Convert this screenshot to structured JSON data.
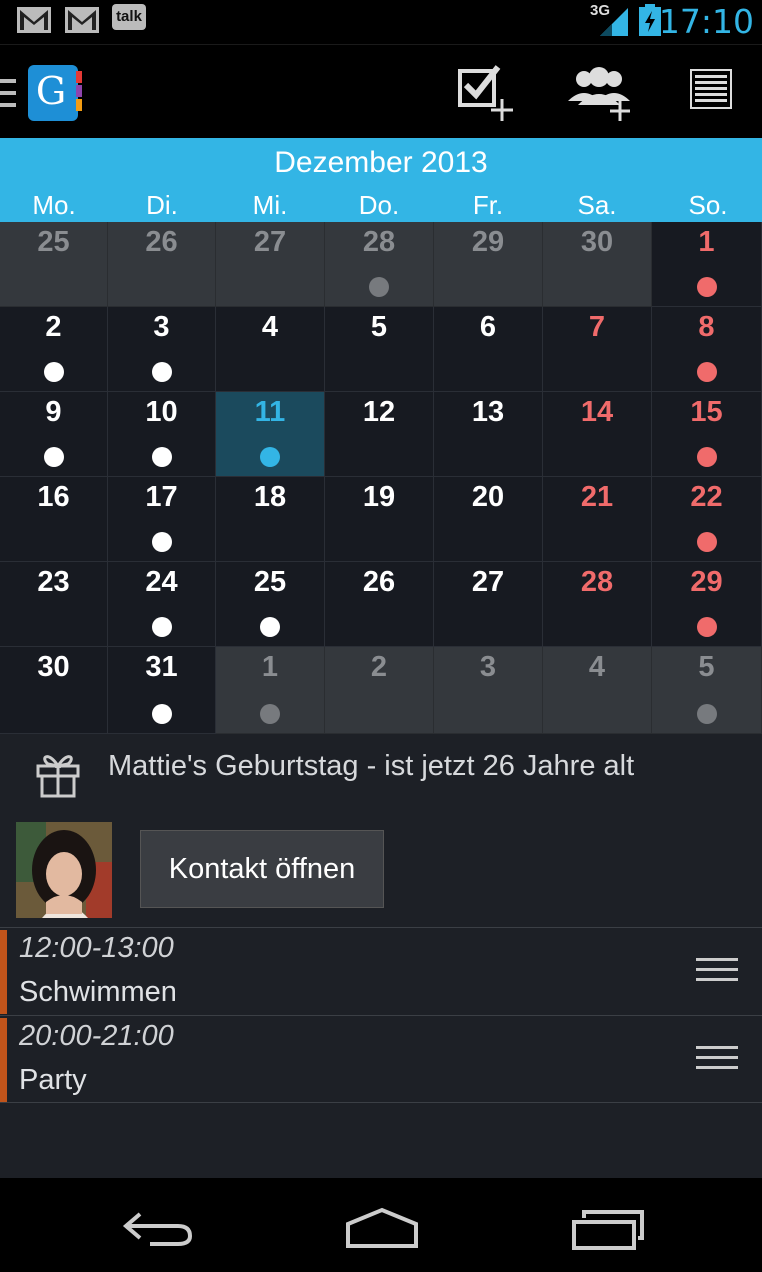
{
  "status_bar": {
    "notifications": [
      "gmail-icon",
      "gmail-icon",
      "talk-icon"
    ],
    "talk_label": "talk",
    "network_label": "3G",
    "time": "17:10",
    "accent": "#33b5e5"
  },
  "action_bar": {
    "app_logo_letter": "G",
    "actions": [
      "add-task-icon",
      "add-contact-icon",
      "list-view-icon"
    ]
  },
  "calendar": {
    "month_title": "Dezember 2013",
    "weekdays": [
      "Mo.",
      "Di.",
      "Mi.",
      "Do.",
      "Fr.",
      "Sa.",
      "So."
    ],
    "weeks": [
      [
        {
          "d": "25",
          "o": true
        },
        {
          "d": "26",
          "o": true
        },
        {
          "d": "27",
          "o": true
        },
        {
          "d": "28",
          "o": true,
          "dot": "grey"
        },
        {
          "d": "29",
          "o": true
        },
        {
          "d": "30",
          "o": true
        },
        {
          "d": "1",
          "red": true,
          "dot": "red"
        }
      ],
      [
        {
          "d": "2",
          "dot": "white"
        },
        {
          "d": "3",
          "dot": "white"
        },
        {
          "d": "4"
        },
        {
          "d": "5"
        },
        {
          "d": "6"
        },
        {
          "d": "7",
          "red": true
        },
        {
          "d": "8",
          "red": true,
          "dot": "red"
        }
      ],
      [
        {
          "d": "9",
          "dot": "white"
        },
        {
          "d": "10",
          "dot": "white"
        },
        {
          "d": "11",
          "today": true,
          "dot": "blue"
        },
        {
          "d": "12"
        },
        {
          "d": "13"
        },
        {
          "d": "14",
          "red": true
        },
        {
          "d": "15",
          "red": true,
          "dot": "red"
        }
      ],
      [
        {
          "d": "16"
        },
        {
          "d": "17",
          "dot": "white"
        },
        {
          "d": "18"
        },
        {
          "d": "19"
        },
        {
          "d": "20"
        },
        {
          "d": "21",
          "red": true
        },
        {
          "d": "22",
          "red": true,
          "dot": "red"
        }
      ],
      [
        {
          "d": "23"
        },
        {
          "d": "24",
          "dot": "white"
        },
        {
          "d": "25",
          "dot": "white"
        },
        {
          "d": "26"
        },
        {
          "d": "27"
        },
        {
          "d": "28",
          "red": true
        },
        {
          "d": "29",
          "red": true,
          "dot": "red"
        }
      ],
      [
        {
          "d": "30"
        },
        {
          "d": "31",
          "dot": "white"
        },
        {
          "d": "1",
          "o": true,
          "dot": "grey"
        },
        {
          "d": "2",
          "o": true
        },
        {
          "d": "3",
          "o": true
        },
        {
          "d": "4",
          "o": true
        },
        {
          "d": "5",
          "o": true,
          "dot": "grey"
        }
      ]
    ],
    "colors": {
      "weekend_red": "#f06b6b",
      "header_blue": "#33b5e5"
    }
  },
  "birthday": {
    "text": "Mattie's Geburtstag - ist jetzt 26 Jahre alt",
    "button_label": "Kontakt öffnen"
  },
  "events": [
    {
      "time": "12:00-13:00",
      "title": "Schwimmen",
      "color": "#c1541b"
    },
    {
      "time": "20:00-21:00",
      "title": "Party",
      "color": "#c1541b"
    }
  ],
  "nav_bar": [
    "back-icon",
    "home-icon",
    "recent-apps-icon"
  ]
}
